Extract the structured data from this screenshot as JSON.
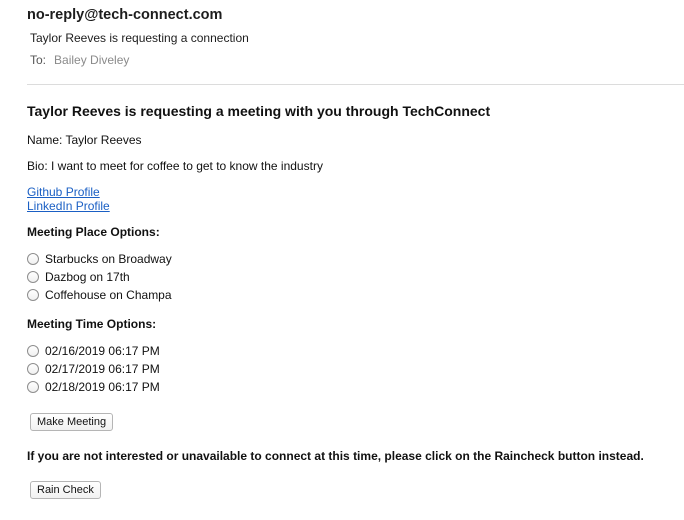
{
  "email": {
    "sender": "no-reply@tech-connect.com",
    "subject": "Taylor Reeves is requesting a connection",
    "to_label": "To:",
    "to_name": "Bailey Diveley"
  },
  "message": {
    "headline": "Taylor Reeves is requesting a meeting with you through TechConnect",
    "name_line": "Name: Taylor Reeves",
    "bio_line": "Bio: I want to meet for coffee to get to know the industry",
    "links": [
      {
        "label": "Github Profile"
      },
      {
        "label": "LinkedIn Profile"
      }
    ],
    "place_title": "Meeting Place Options:",
    "places": [
      {
        "label": "Starbucks on Broadway",
        "selected": false
      },
      {
        "label": "Dazbog on 17th",
        "selected": false
      },
      {
        "label": "Coffehouse on Champa",
        "selected": false
      }
    ],
    "time_title": "Meeting Time Options:",
    "times": [
      {
        "label": "02/16/2019 06:17 PM",
        "selected": false
      },
      {
        "label": "02/17/2019 06:17 PM",
        "selected": false
      },
      {
        "label": "02/18/2019 06:17 PM",
        "selected": false
      }
    ],
    "make_meeting_label": "Make Meeting",
    "notice": "If you are not interested or unavailable to connect at this time, please click on the Raincheck button instead.",
    "raincheck_label": "Rain Check"
  }
}
